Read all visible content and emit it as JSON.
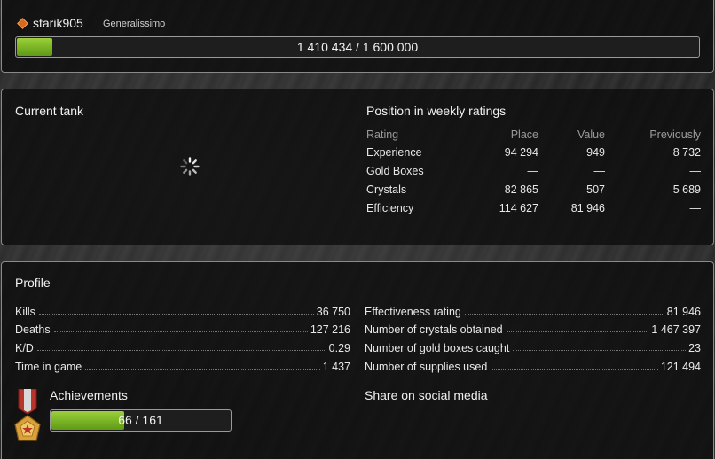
{
  "header": {
    "username": "starik905",
    "rank": "Generalissimo",
    "xp_text": "1 410 434 / 1 600 000",
    "xp_current": 1410434,
    "xp_max": 1600000,
    "rank_icon": "rank-diamond-icon"
  },
  "current_tank": {
    "title": "Current tank",
    "loading_icon": "loading-spinner-icon"
  },
  "weekly": {
    "title": "Position in weekly ratings",
    "headers": {
      "rating": "Rating",
      "place": "Place",
      "value": "Value",
      "previously": "Previously"
    },
    "rows": [
      {
        "rating": "Experience",
        "place": "94 294",
        "value": "949",
        "previously": "8 732"
      },
      {
        "rating": "Gold Boxes",
        "place": "—",
        "value": "—",
        "previously": "—"
      },
      {
        "rating": "Crystals",
        "place": "82 865",
        "value": "507",
        "previously": "5 689"
      },
      {
        "rating": "Efficiency",
        "place": "114 627",
        "value": "81 946",
        "previously": "—"
      }
    ]
  },
  "profile": {
    "title": "Profile",
    "left_stats": [
      {
        "label": "Kills",
        "value": "36 750"
      },
      {
        "label": "Deaths",
        "value": "127 216"
      },
      {
        "label": "K/D",
        "value": "0.29"
      },
      {
        "label": "Time in game",
        "value": "1 437"
      }
    ],
    "right_stats": [
      {
        "label": "Effectiveness rating",
        "value": "81 946"
      },
      {
        "label": "Number of crystals obtained",
        "value": "1 467 397"
      },
      {
        "label": "Number of gold boxes caught",
        "value": "23"
      },
      {
        "label": "Number of supplies used",
        "value": "121 494"
      }
    ],
    "achievements": {
      "label": "Achievements",
      "progress_text": "66 / 161",
      "current": 66,
      "total": 161,
      "icon": "medal-icon"
    },
    "share_label": "Share on social media"
  },
  "colors": {
    "progress_fill": "#7bb52a",
    "panel_border": "#8a8a8a",
    "muted_text": "#9a9a9a"
  }
}
